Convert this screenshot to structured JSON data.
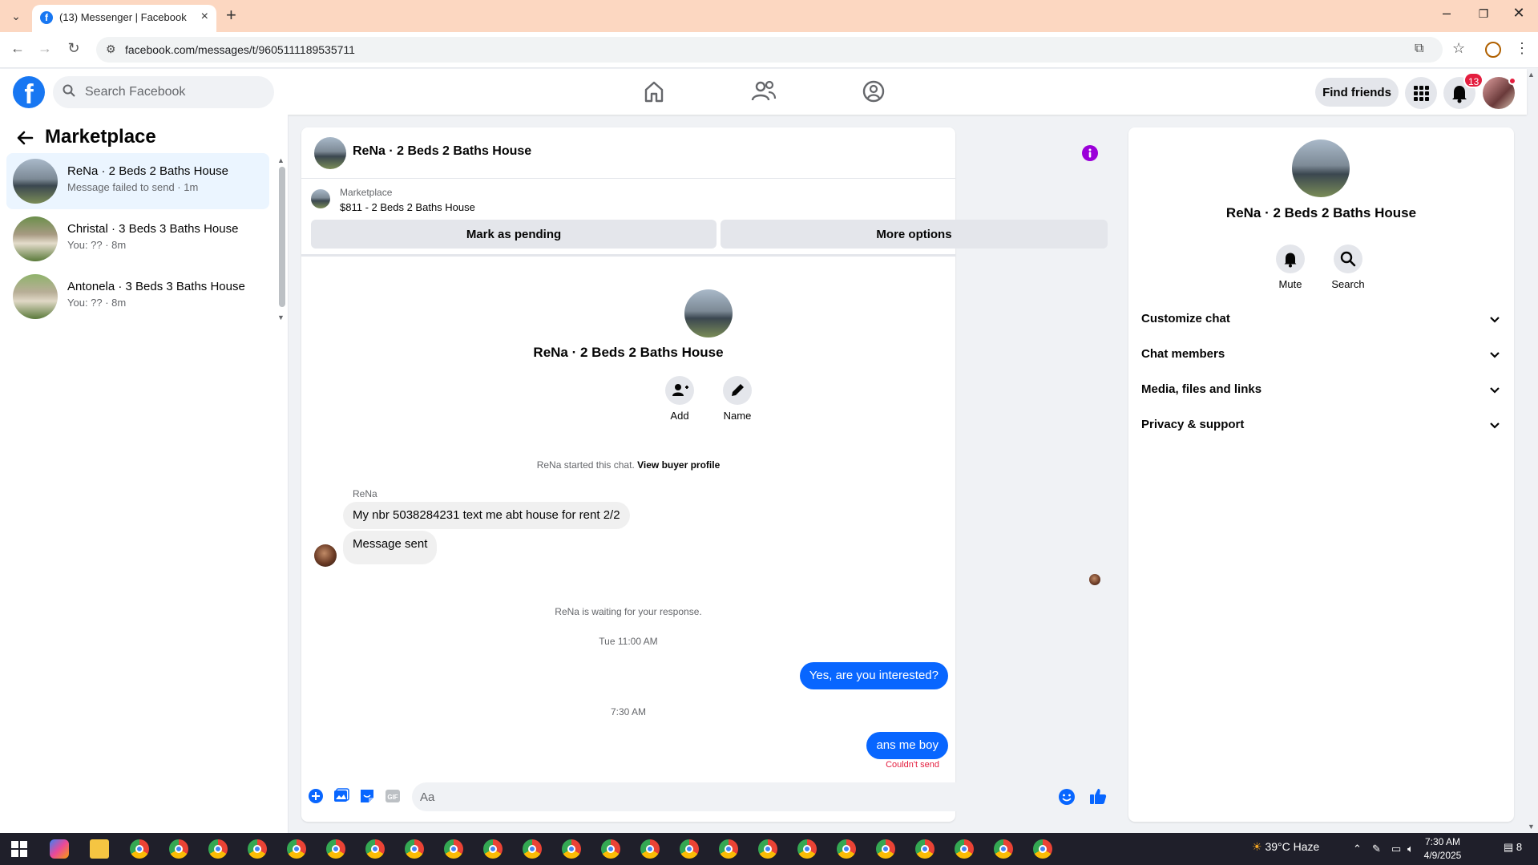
{
  "browser": {
    "tab_title": "(13) Messenger | Facebook",
    "url": "facebook.com/messages/t/9605111189535711"
  },
  "header": {
    "search_placeholder": "Search Facebook",
    "find_friends": "Find friends",
    "notification_count": "13",
    "brand_color": "#1877f2"
  },
  "sidebar": {
    "title": "Marketplace",
    "conversations": [
      {
        "name": "ReNa · 2 Beds 2 Baths House",
        "snippet": "Message failed to send · 1m"
      },
      {
        "name": "Christal · 3 Beds 3 Baths House",
        "snippet": "You: ?? · 8m"
      },
      {
        "name": "Antonela · 3 Beds 3 Baths House",
        "snippet": "You: ?? · 8m"
      }
    ]
  },
  "chat": {
    "title": "ReNa · 2 Beds 2 Baths House",
    "marketplace_label": "Marketplace",
    "listing": "$811 - 2 Beds 2 Baths House",
    "mark_pending": "Mark as pending",
    "more_options": "More options",
    "intro_name": "ReNa · 2 Beds 2 Baths House",
    "add_label": "Add",
    "name_label": "Name",
    "started_note": "ReNa started this chat.",
    "view_profile": "View buyer profile",
    "sender": "ReNa",
    "msg1": "My nbr 5038284231 text me abt house for rent 2/2",
    "msg2": "Message sent",
    "waiting": "ReNa is waiting for your response.",
    "time1": "Tue 11:00 AM",
    "out1": "Yes, are you interested?",
    "time2": "7:30 AM",
    "out2": "ans me boy",
    "failed": "Couldn't send",
    "composer_placeholder": "Aa"
  },
  "details": {
    "name": "ReNa · 2 Beds 2 Baths House",
    "mute": "Mute",
    "search": "Search",
    "sections": [
      "Customize chat",
      "Chat members",
      "Media, files and links",
      "Privacy & support"
    ]
  },
  "taskbar": {
    "weather": "39°C  Haze",
    "time": "7:30 AM",
    "date": "4/9/2025",
    "notif_count": "8"
  }
}
